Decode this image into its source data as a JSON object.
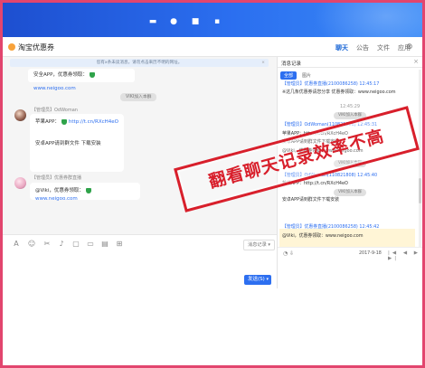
{
  "window": {
    "title": "淘宝优惠券",
    "right_tabs": [
      "聊天",
      "公告",
      "文件",
      "应用"
    ],
    "more": "⊗"
  },
  "chat": {
    "notice": "您有x条未读消息，请勿点击来历不明的网址。",
    "prev_message": {
      "text": "安全APP，优惠券领取：",
      "link": "www.neigoo.com"
    },
    "system_1": "VIKI加入本群",
    "message_1": {
      "sender": "【管理员】OdWoman",
      "line1_prefix": "苹果APP：",
      "line1_link": "http://t.cn/RXcH4eO",
      "line2": "安卓APP请到群文件 下载安装"
    },
    "message_2": {
      "sender": "【管理员】优惠券群直播",
      "prefix": "@Viki，优惠券领取：",
      "link": "www.neigoo.com"
    }
  },
  "toolbar": {
    "icons": [
      "A",
      "☺",
      "✂",
      "♪",
      "▢",
      "▭",
      "▤",
      "⊞"
    ],
    "history_button": "消息记录 ▾"
  },
  "send_button": {
    "label": "发送(S)",
    "arrow": "▾"
  },
  "history": {
    "header": "消息记录",
    "close": "×",
    "filter_all": "全部",
    "filter_image": "图片",
    "items": [
      {
        "kind": "blue",
        "text": "【管理员】优惠券直播(2100086258) 12:45:17"
      },
      {
        "kind": "normal",
        "text": "※这几条优惠券请您分享 优惠券领取：www.neigoo.com"
      },
      {
        "kind": "center",
        "text": "12:45:29"
      },
      {
        "kind": "pill",
        "text": "VIKI加入本群"
      },
      {
        "kind": "blue",
        "text": "【管理员】OdWoman(110821808) 12:45:31"
      },
      {
        "kind": "normal",
        "text": "苹果APP：http://t.cn/RXcH4eO"
      },
      {
        "kind": "normal",
        "text": "安卓APP请到群文件下载安装"
      },
      {
        "kind": "normal",
        "text": "@Viki，优惠券领取：www.neigoo.com"
      },
      {
        "kind": "pill",
        "text": "VIKI加入本群"
      },
      {
        "kind": "blue",
        "text": "【管理员】OdWoman(110821808) 12:45:40"
      },
      {
        "kind": "normal",
        "text": "苹果APP：http://t.cn/RXcH4eO"
      },
      {
        "kind": "pill",
        "text": "VIKI加入本群"
      },
      {
        "kind": "normal",
        "text": "安卓APP请到群文件下载安装"
      },
      {
        "kind": "blue",
        "text": "【管理员】优惠券直播(2100086258) 12:45:42"
      },
      {
        "kind": "normal",
        "text": "@Viki，优惠券领取：www.neigoo.com"
      }
    ],
    "footer_date": "2017-9-18",
    "footer_icons": "◔ ⇩",
    "footer_nav": "|◀ ◀ ▶ ▶|"
  },
  "stamp": {
    "text": "翻看聊天记录效率不高"
  },
  "colors": {
    "accent": "#2d6ff0",
    "stamp": "#d81f2b",
    "frame": "#e2456e"
  }
}
